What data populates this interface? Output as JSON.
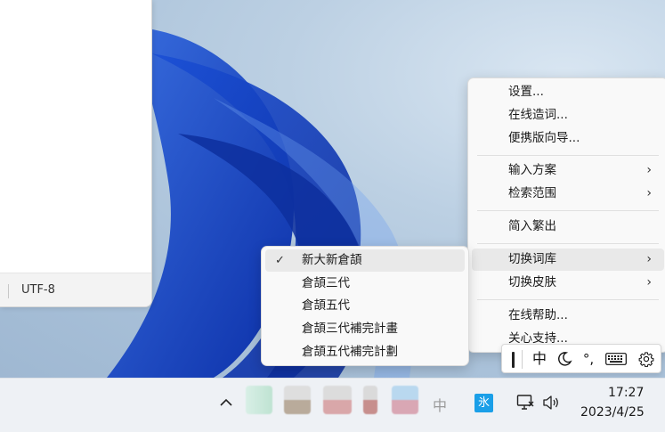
{
  "notepad": {
    "encoding": "UTF-8"
  },
  "main_menu": {
    "items": [
      {
        "label": "设置...",
        "has_submenu": false
      },
      {
        "label": "在线造词...",
        "has_submenu": false
      },
      {
        "label": "便携版向导...",
        "has_submenu": false
      },
      {
        "label": "输入方案",
        "has_submenu": true
      },
      {
        "label": "检索范围",
        "has_submenu": true
      },
      {
        "label": "简入繁出",
        "has_submenu": false
      },
      {
        "label": "切换词库",
        "has_submenu": true,
        "active": true
      },
      {
        "label": "切换皮肤",
        "has_submenu": true
      },
      {
        "label": "在线帮助...",
        "has_submenu": false
      },
      {
        "label": "关心支持...",
        "has_submenu": false
      }
    ],
    "arrow": "›"
  },
  "sub_menu": {
    "items": [
      {
        "label": "新大新倉頡",
        "checked": true
      },
      {
        "label": "倉頡三代",
        "checked": false
      },
      {
        "label": "倉頡五代",
        "checked": false
      },
      {
        "label": "倉頡三代補完計畫",
        "checked": false
      },
      {
        "label": "倉頡五代補完計劃",
        "checked": false
      }
    ],
    "check_mark": "✓"
  },
  "ime_toolbar": {
    "mode": "中",
    "icons": [
      "moon-icon",
      "punctuation-icon",
      "keyboard-icon",
      "settings-icon"
    ],
    "punct": "°,"
  },
  "taskbar": {
    "chevron": "^",
    "ime_indicator": "中",
    "app_badge": "氷",
    "time": "17:27",
    "date": "2023/4/25"
  }
}
